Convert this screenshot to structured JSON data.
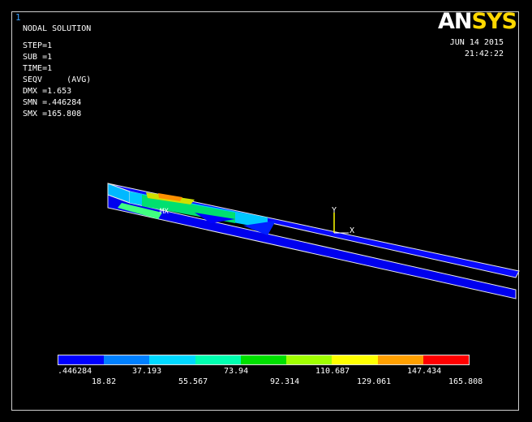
{
  "window_number": "1",
  "logo": {
    "part1": "AN",
    "part2": "SYS"
  },
  "header": {
    "title": "NODAL SOLUTION",
    "step": "STEP=1",
    "sub": "SUB =1",
    "time": "TIME=1",
    "seqv": "SEQV     (AVG)",
    "dmx": "DMX =1.653",
    "smn": "SMN =.446284",
    "smx": "SMX =165.808"
  },
  "datetime": {
    "date": "JUN 14 2015",
    "time": "21:42:22"
  },
  "triad": {
    "y": "Y",
    "x": "X"
  },
  "mx_label": "MX",
  "legend": {
    "colors": [
      "#0000ff",
      "#0080ff",
      "#00d8ff",
      "#00ffb0",
      "#00e000",
      "#a0ff00",
      "#ffff00",
      "#ffa000",
      "#ff0000"
    ],
    "top_labels": [
      ".446284",
      "37.193",
      "73.94",
      "110.687",
      "147.434"
    ],
    "bottom_labels": [
      "18.82",
      "55.567",
      "92.314",
      "129.061",
      "165.808"
    ]
  },
  "colors": {
    "background": "#000000",
    "frame": "#cfcfcf",
    "logo_accent": "#ffd800"
  }
}
